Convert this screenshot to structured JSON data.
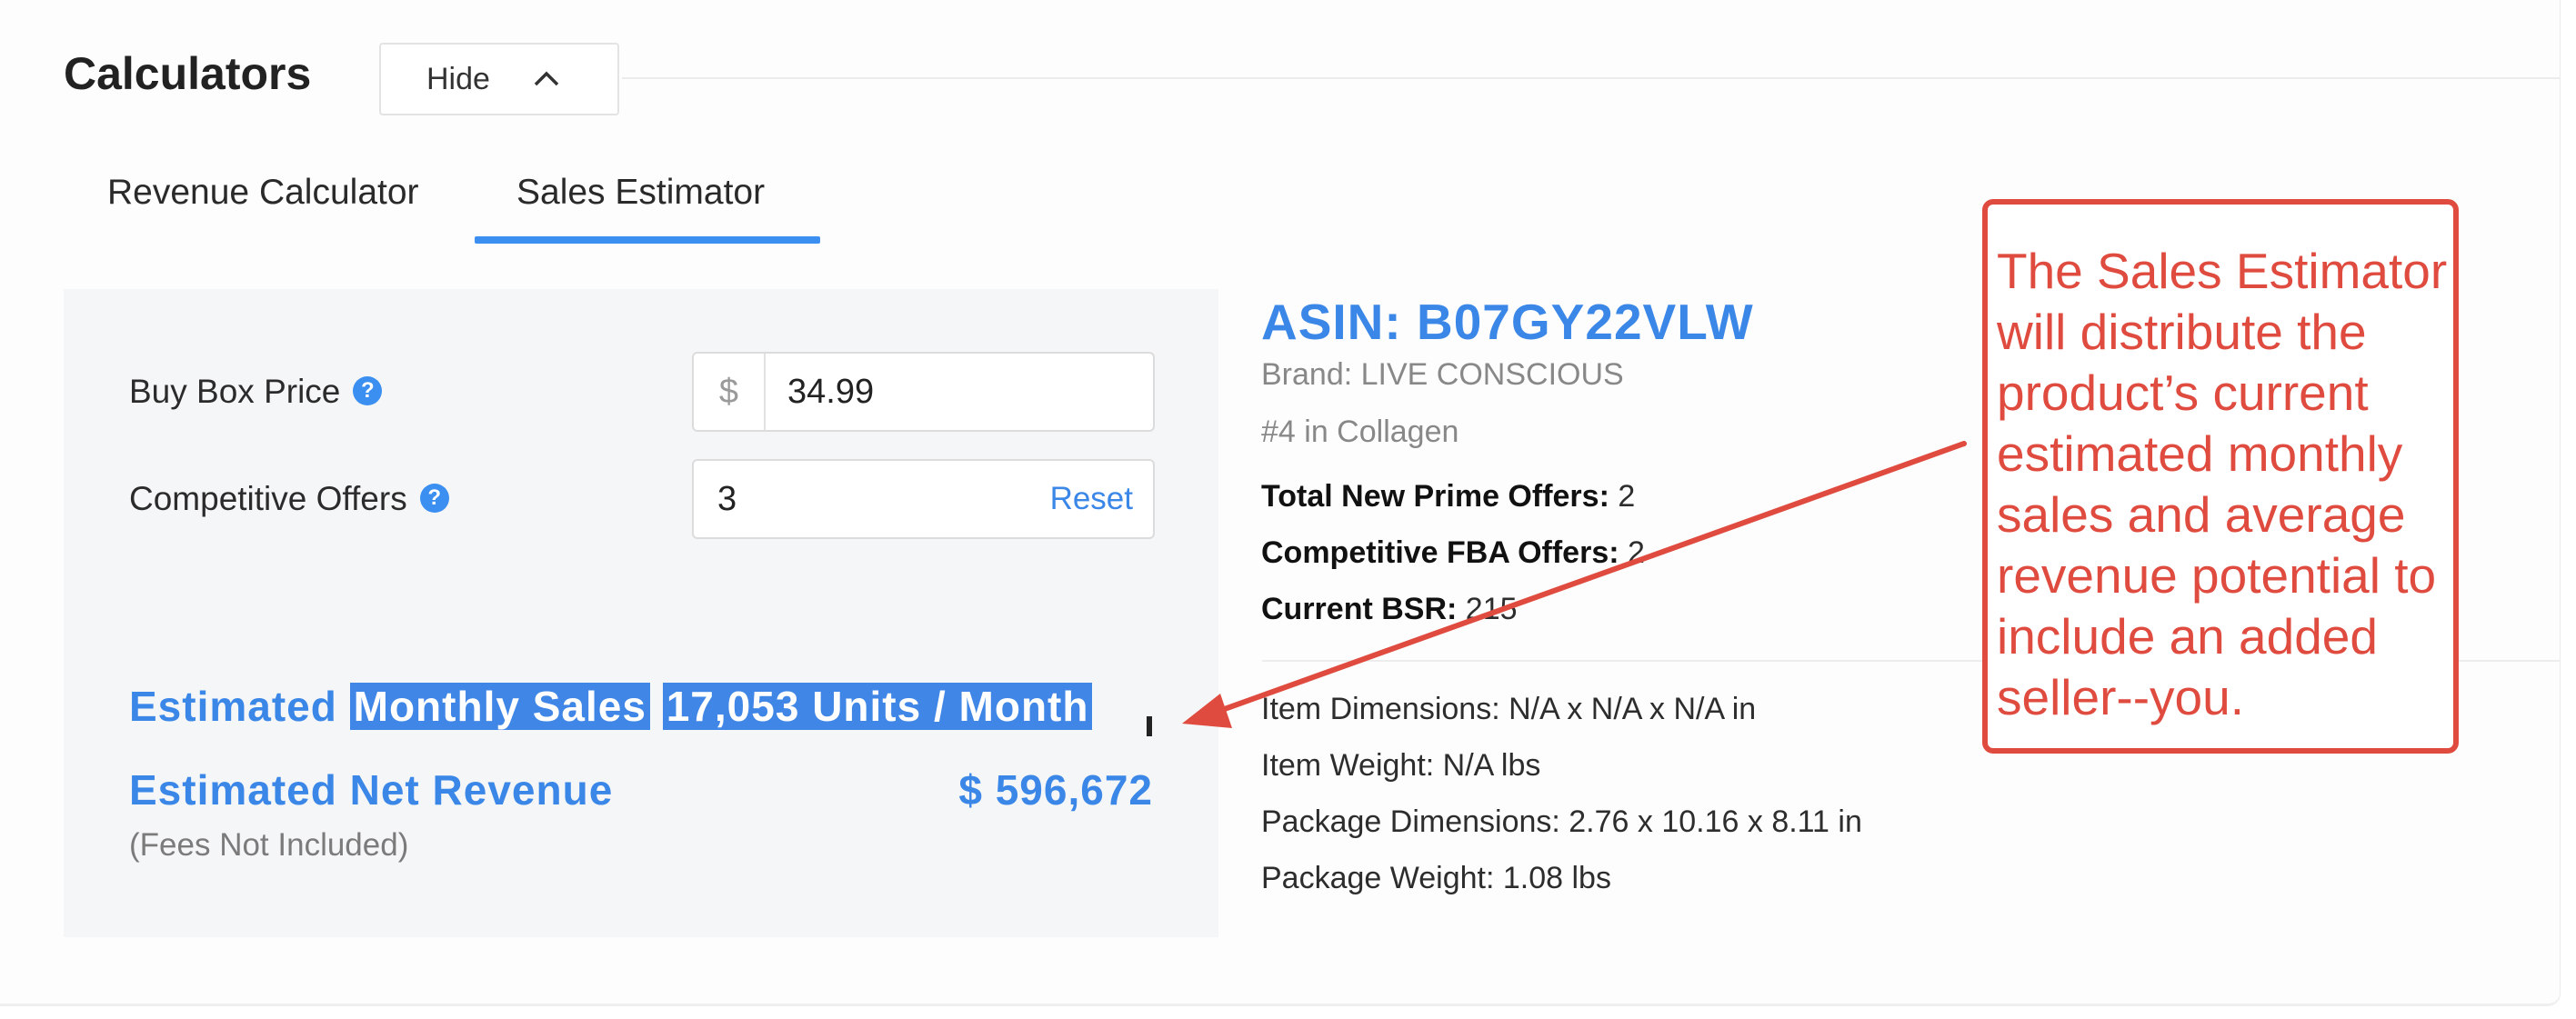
{
  "header": {
    "title": "Calculators",
    "hide_label": "Hide"
  },
  "tabs": {
    "revenue": "Revenue Calculator",
    "sales": "Sales Estimator"
  },
  "form": {
    "buy_box_label": "Buy Box Price",
    "currency_symbol": "$",
    "buy_box_value": "34.99",
    "competitive_label": "Competitive Offers",
    "competitive_value": "3",
    "reset_label": "Reset"
  },
  "results": {
    "est_word": "Estimated",
    "monthly_sales_label": "Monthly Sales",
    "monthly_sales_value": "17,053 Units / Month",
    "net_revenue_label": "Estimated Net Revenue",
    "net_revenue_value": "$ 596,672",
    "fees_note": "(Fees Not Included)"
  },
  "product": {
    "asin": "ASIN: B07GY22VLW",
    "brand": "Brand: LIVE CONSCIOUS",
    "rank": "#4 in Collagen",
    "prime_offers_label": "Total New Prime Offers:",
    "prime_offers_value": "2",
    "fba_offers_label": "Competitive FBA Offers:",
    "fba_offers_value": "2",
    "bsr_label": "Current BSR:",
    "bsr_value": "215",
    "item_dimensions": "Item Dimensions: N/A x N/A x N/A in",
    "item_weight": "Item Weight: N/A lbs",
    "package_dimensions": "Package Dimensions: 2.76 x 10.16 x 8.11 in",
    "package_weight": "Package Weight: 1.08 lbs"
  },
  "callout": {
    "text": "The Sales Estimator will distribute the product’s current estimated monthly sales and average revenue potential to include an added seller--you."
  },
  "colors": {
    "accent": "#3b87e8",
    "callout_red": "#e04b3f",
    "panel_bg": "#f5f6f7"
  },
  "icons": [
    "chevron-up-icon",
    "help-icon",
    "help-icon"
  ]
}
